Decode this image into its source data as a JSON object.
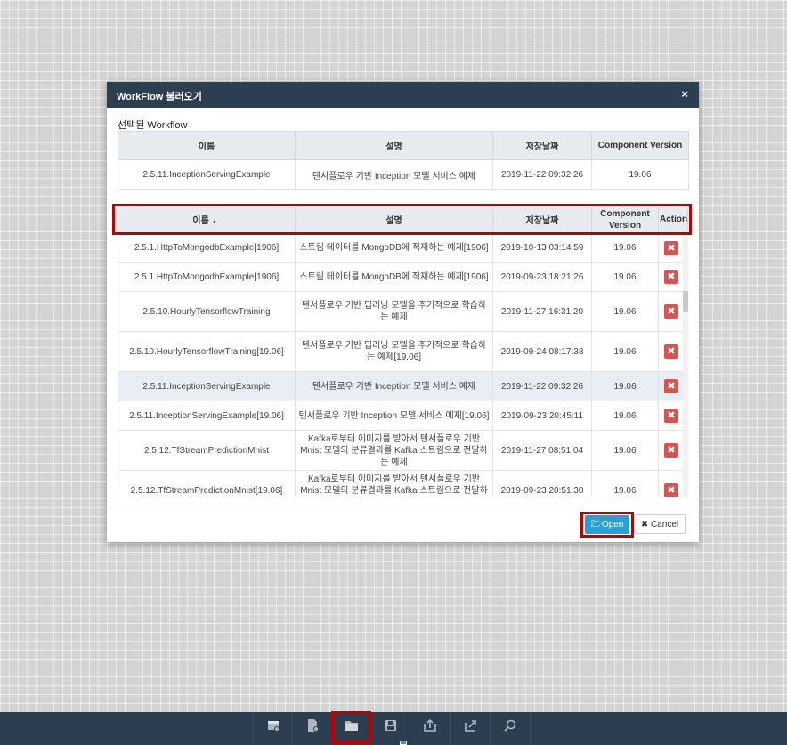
{
  "dialog": {
    "title": "WorkFlow 불러오기",
    "close": "×",
    "selected_label": "선택된 Workflow",
    "open_label": "Open",
    "cancel_label": "Cancel"
  },
  "selected_table": {
    "headers": [
      "이름",
      "설명",
      "저장날짜",
      "Component Version"
    ],
    "row": [
      "2.5.11.InceptionServingExample",
      "텐서플로우 기반 Inception 모델 서비스 예제",
      "2019-11-22 09:32:26",
      "19.06"
    ]
  },
  "list_table": {
    "headers": [
      "이름",
      "설명",
      "저장날짜",
      "Component Version",
      "Action"
    ],
    "sort_indicator": "▲",
    "rows": [
      {
        "name": "2.5.1.HttpToMongodbExample[1906]",
        "desc": "스트림 데이터를 MongoDB에 적재하는 예제[1906]",
        "date": "2019-10-13 03:14:59",
        "version": "19.06"
      },
      {
        "name": "2.5.1.HttpToMongodbExample[1906]",
        "desc": "스트림 데이터를 MongoDB에 적재하는 예제[1906]",
        "date": "2019-09-23 18:21:26",
        "version": "19.06"
      },
      {
        "name": "2.5.10.HourlyTensorflowTraining",
        "desc": "텐서플로우 기반 딥러닝 모델을 주기적으로 학습하는 예제",
        "date": "2019-11-27 16:31:20",
        "version": "19.06"
      },
      {
        "name": "2.5.10.HourlyTensorflowTraining[19.06]",
        "desc": "텐서플로우 기반 딥러닝 모델을 주기적으로 학습하는 예제[19.06]",
        "date": "2019-09-24 08:17:38",
        "version": "19.06"
      },
      {
        "name": "2.5.11.InceptionServingExample",
        "desc": "텐서플로우 기반 Inception 모델 서비스 예제",
        "date": "2019-11-22 09:32:26",
        "version": "19.06",
        "selected": true
      },
      {
        "name": "2.5.11.InceptionServingExample[19.06]",
        "desc": "텐서플로우 기반 Inception 모델 서비스 예제[19.06]",
        "date": "2019-09-23 20:45:11",
        "version": "19.06"
      },
      {
        "name": "2.5.12.TfStreamPredictionMnist",
        "desc": "Kafka로부터 이미지를 받아서 텐서플로우 기반 Mnist 모델의 분류결과를 Kafka 스트림으로 전달하는 예제",
        "date": "2019-11-27 08:51:04",
        "version": "19.06"
      },
      {
        "name": "2.5.12.TfStreamPredictionMnist[19.06]",
        "desc": "Kafka로부터 이미지를 받아서 텐서플로우 기반 Mnist 모델의 분류결과를 Kafka 스트림으로 전달하는 예제",
        "date": "2019-09-23 20:51:30",
        "version": "19.06"
      }
    ],
    "delete_glyph": "✖"
  },
  "toolbar": {
    "icons": [
      "new-workflow-icon",
      "new-document-icon",
      "open-folder-icon",
      "save-icon",
      "import-icon",
      "export-icon",
      "search-icon"
    ]
  },
  "colors": {
    "header_bg": "#2d3e50",
    "primary": "#2a9fd6",
    "danger": "#d9534f",
    "highlight": "#c00000"
  }
}
